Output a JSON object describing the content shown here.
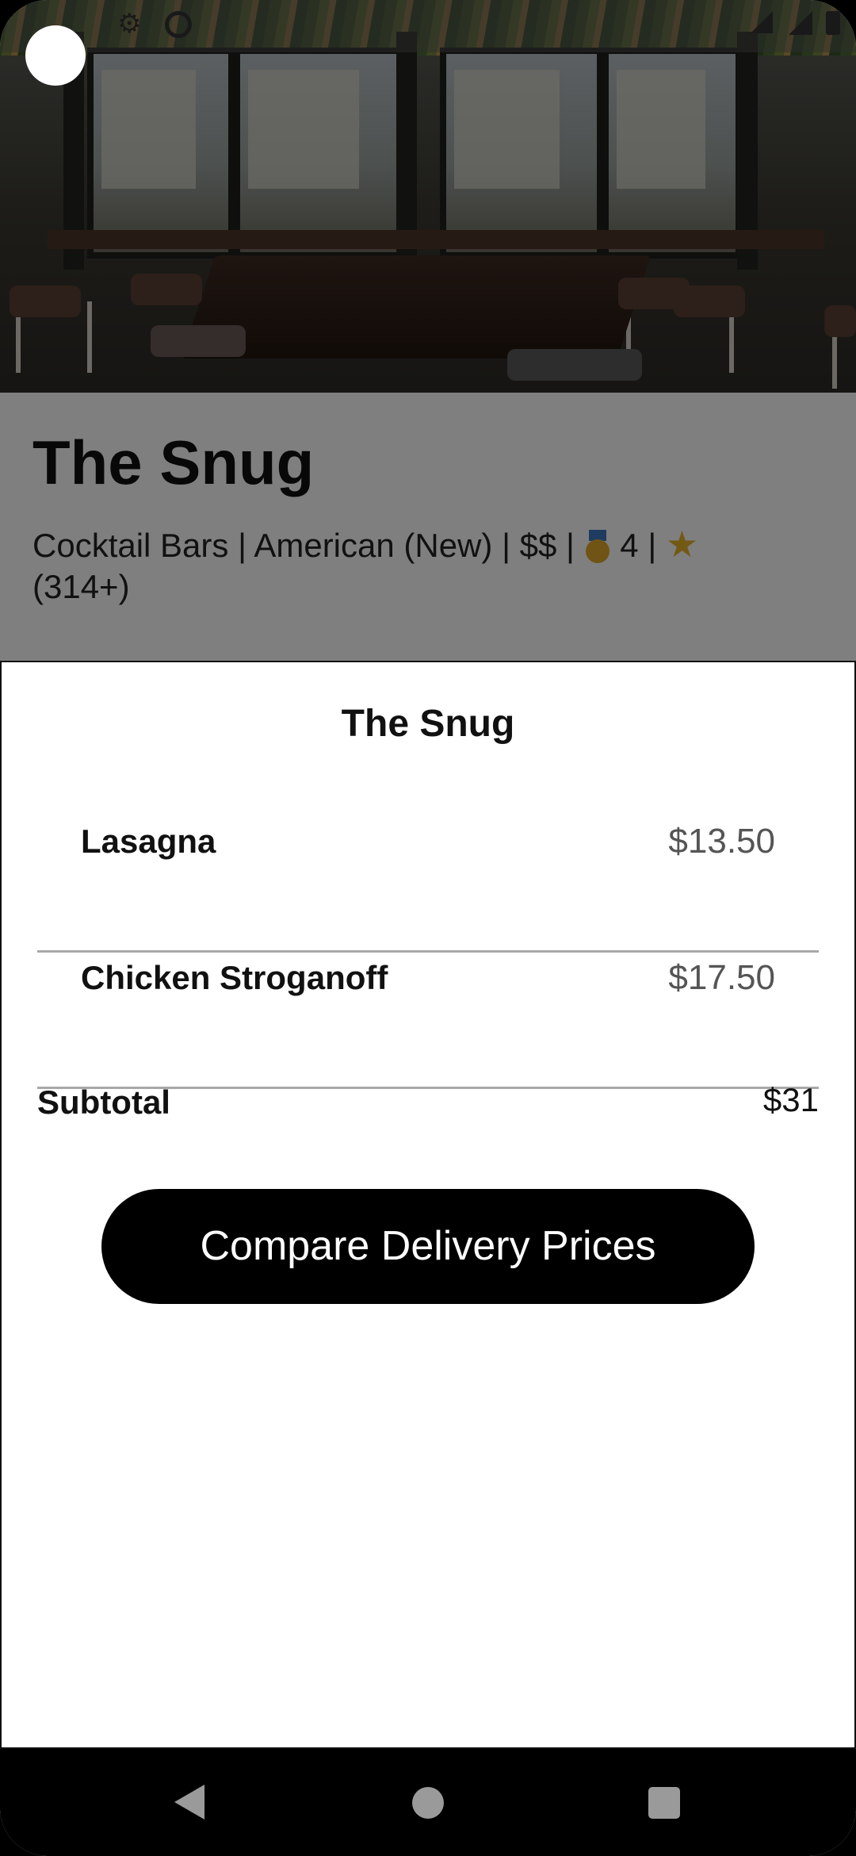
{
  "restaurant": {
    "name": "The Snug",
    "categories": "Cocktail Bars | American (New)",
    "price_level": "$$",
    "rank": "4",
    "review_count": "(314+)"
  },
  "sheet": {
    "title": "The Snug",
    "items": [
      {
        "name": "Lasagna",
        "price": "$13.50"
      },
      {
        "name": "Chicken Stroganoff",
        "price": "$17.50"
      }
    ],
    "subtotal_label": "Subtotal",
    "subtotal_value": "$31",
    "cta_label": "Compare Delivery Prices"
  },
  "icons": {
    "status": [
      "settings-icon",
      "notification-icon",
      "wifi-icon",
      "signal-icon",
      "battery-icon"
    ],
    "meta": [
      "medal-icon",
      "star-icon"
    ],
    "nav": [
      "back-icon",
      "home-icon",
      "recents-icon"
    ]
  },
  "colors": {
    "cta_background": "#000000",
    "star": "#e5b52a",
    "medal": "#e0a92c"
  }
}
